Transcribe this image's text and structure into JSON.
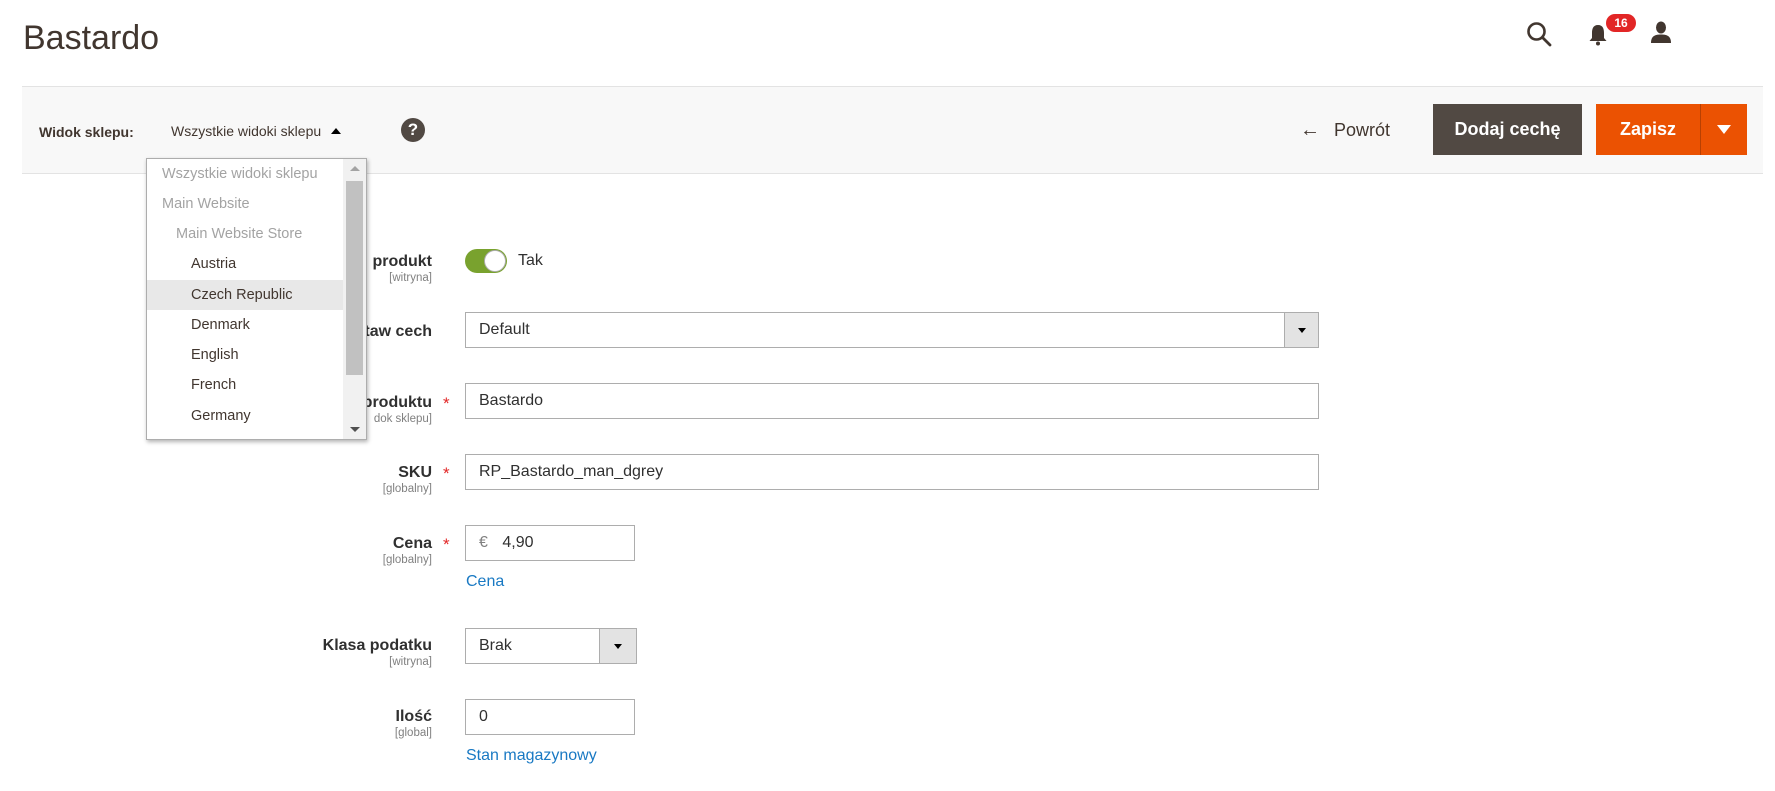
{
  "header": {
    "title": "Bastardo",
    "notifications_count": "16",
    "icons": {
      "search": "search-icon",
      "notifications": "bell-icon",
      "account": "user-icon"
    }
  },
  "toolbar": {
    "store_view_label": "Widok sklepu:",
    "store_view_value": "Wszystkie widoki sklepu",
    "help": "?",
    "back_label": "Powrót",
    "back_arrow": "←",
    "add_attribute_label": "Dodaj cechę",
    "save_label": "Zapisz"
  },
  "store_dropdown": {
    "items": [
      {
        "label": "Wszystkie widoki sklepu",
        "level": 0,
        "enabled": false
      },
      {
        "label": "Main Website",
        "level": 0,
        "enabled": false
      },
      {
        "label": "Main Website Store",
        "level": 1,
        "enabled": false
      },
      {
        "label": "Austria",
        "level": 2,
        "enabled": true
      },
      {
        "label": "Czech Republic",
        "level": 2,
        "enabled": true,
        "hovered": true
      },
      {
        "label": "Denmark",
        "level": 2,
        "enabled": true
      },
      {
        "label": "English",
        "level": 2,
        "enabled": true
      },
      {
        "label": "French",
        "level": 2,
        "enabled": true
      },
      {
        "label": "Germany",
        "level": 2,
        "enabled": true
      }
    ]
  },
  "form": {
    "enable_product": {
      "label": "produkt",
      "scope": "[witryna]",
      "value": "Tak",
      "checked": true
    },
    "attribute_set": {
      "label": "taw cech",
      "value": "Default"
    },
    "product_name": {
      "label": "produktu",
      "scope": "dok sklepu]",
      "value": "Bastardo",
      "required": true
    },
    "sku": {
      "label": "SKU",
      "scope": "[globalny]",
      "value": "RP_Bastardo_man_dgrey",
      "required": true
    },
    "price": {
      "label": "Cena",
      "scope": "[globalny]",
      "currency": "€",
      "value": "4,90",
      "required": true,
      "link": "Cena"
    },
    "tax_class": {
      "label": "Klasa podatku",
      "scope": "[witryna]",
      "value": "Brak"
    },
    "quantity": {
      "label": "Ilość",
      "scope": "[global]",
      "value": "0",
      "link": "Stan magazynowy"
    },
    "required_marker": "*"
  }
}
